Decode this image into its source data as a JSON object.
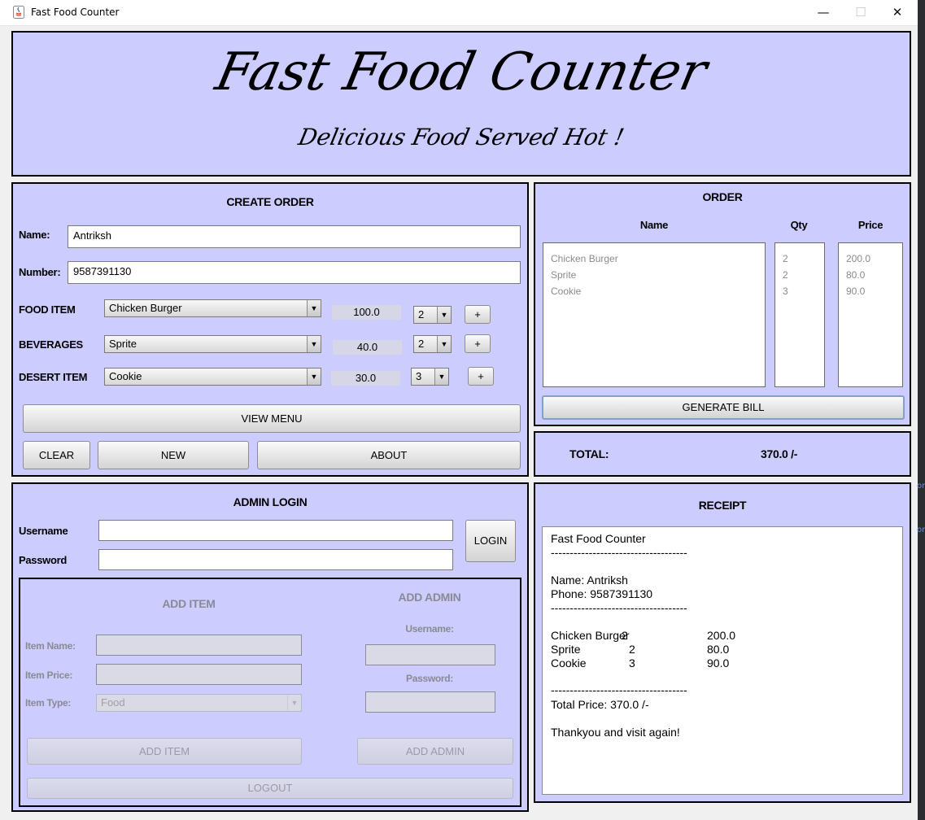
{
  "window": {
    "title": "Fast Food Counter",
    "min_icon": "minimize-icon",
    "max_icon": "maximize-icon",
    "close_icon": "close-icon"
  },
  "edge_fragment": {
    "line1": "on",
    "line2": "on"
  },
  "header": {
    "title": "Fast Food Counter",
    "subtitle": "Delicious Food Served Hot !"
  },
  "create_order": {
    "heading": "CREATE ORDER",
    "name_label": "Name:",
    "name_value": "Antriksh",
    "number_label": "Number:",
    "number_value": "9587391130",
    "rows": [
      {
        "label": "FOOD  ITEM",
        "item": "Chicken Burger",
        "price": "100.0",
        "qty": "2",
        "plus": "+"
      },
      {
        "label": "BEVERAGES",
        "item": "Sprite",
        "price": "40.0",
        "qty": "2",
        "plus": "+"
      },
      {
        "label": "DESERT ITEM",
        "item": "Cookie",
        "price": "30.0",
        "qty": "3",
        "plus": "+"
      }
    ],
    "view_menu": "VIEW MENU",
    "clear": "CLEAR",
    "new": "NEW",
    "about": "ABOUT"
  },
  "order": {
    "heading": "ORDER",
    "col_name": "Name",
    "col_qty": "Qty",
    "col_price": "Price",
    "names": [
      "Chicken Burger",
      "Sprite",
      "Cookie"
    ],
    "qtys": [
      "2",
      "2",
      "3"
    ],
    "prices": [
      "200.0",
      "80.0",
      "90.0"
    ],
    "generate_bill": "GENERATE BILL"
  },
  "total": {
    "label": "TOTAL:",
    "value": "370.0 /-"
  },
  "admin": {
    "heading": "ADMIN LOGIN",
    "username_label": "Username",
    "password_label": "Password",
    "username_value": "",
    "password_value": "",
    "login": "LOGIN",
    "add_item": {
      "heading": "ADD ITEM",
      "name_label": "Item Name:",
      "price_label": "Item Price:",
      "type_label": "Item  Type:",
      "type_value": "Food",
      "button": "ADD ITEM"
    },
    "add_admin": {
      "heading": "ADD ADMIN",
      "username_label": "Username:",
      "password_label": "Password:",
      "button": "ADD ADMIN"
    },
    "logout": "LOGOUT"
  },
  "receipt": {
    "heading": "RECEIPT",
    "title": "Fast Food Counter",
    "divider": "------------------------------------",
    "name_line": "Name: Antriksh",
    "phone_line": "Phone: 9587391130",
    "items": [
      {
        "name": "Chicken Burger",
        "qty": "2",
        "price": "200.0"
      },
      {
        "name": "Sprite",
        "qty": "2",
        "price": "80.0"
      },
      {
        "name": "Cookie",
        "qty": "3",
        "price": "90.0"
      }
    ],
    "total_line": "Total Price: 370.0 /-",
    "thanks": "Thankyou and visit again!"
  }
}
